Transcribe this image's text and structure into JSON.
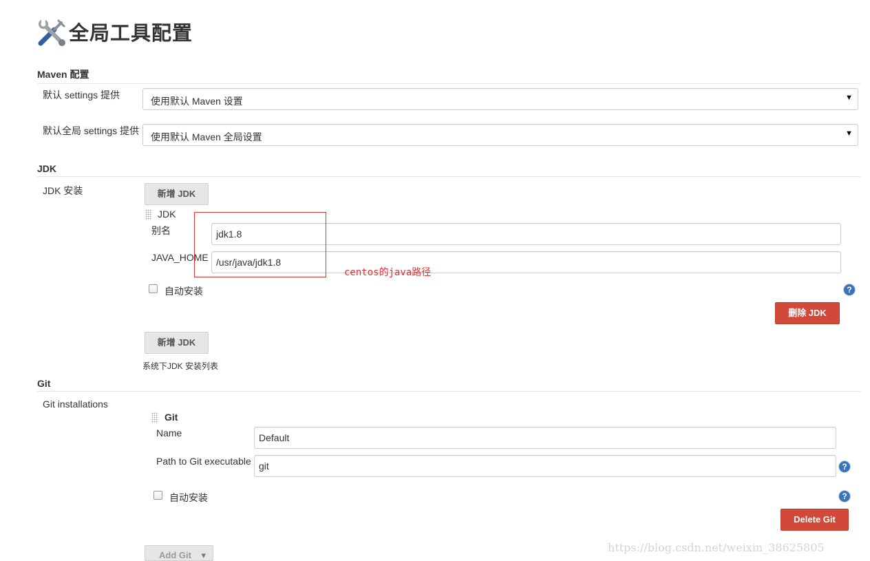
{
  "page": {
    "title": "全局工具配置",
    "title_icon": "wrench-screwdriver-icon"
  },
  "maven": {
    "section_title": "Maven 配置",
    "settings_label": "默认 settings 提供",
    "settings_value": "使用默认 Maven 设置",
    "global_settings_label": "默认全局 settings 提供",
    "global_settings_value": "使用默认 Maven 全局设置",
    "arrow": "▼"
  },
  "jdk": {
    "section_title": "JDK",
    "install_label": "JDK 安装",
    "add_button": "新增 JDK",
    "item_title": "JDK",
    "alias_label": "别名",
    "alias_value": "jdk1.8",
    "java_home_label": "JAVA_HOME",
    "java_home_value": "/usr/java/jdk1.8",
    "auto_install_label": "自动安装",
    "delete_button": "删除 JDK",
    "add_button_bottom": "新增 JDK",
    "list_note": "系统下JDK 安装列表"
  },
  "annotation": {
    "text": "centos的java路径",
    "color": "#e03030"
  },
  "git": {
    "section_title": "Git",
    "install_label": "Git installations",
    "item_title": "Git",
    "name_label": "Name",
    "name_value": "Default",
    "path_label": "Path to Git executable",
    "path_value": "git",
    "auto_install_label": "自动安装",
    "delete_button": "Delete Git",
    "add_button": "Add Git",
    "add_arrow": "▾"
  },
  "help_icon": "?",
  "watermark": "https://blog.csdn.net/weixin_38625805",
  "colors": {
    "danger": "#d24939",
    "help": "#3b73b9",
    "annotation": "#e03030"
  }
}
